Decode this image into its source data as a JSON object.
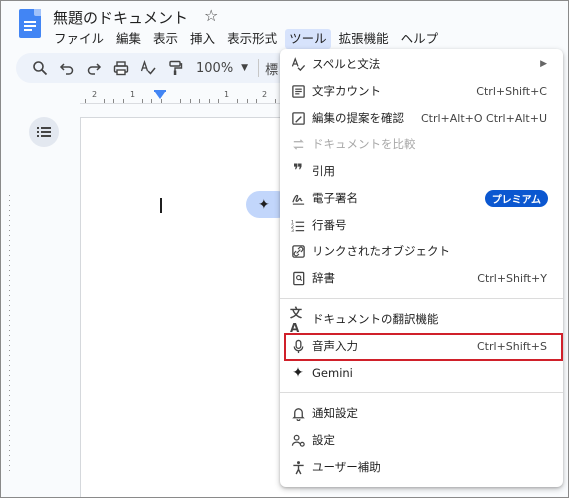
{
  "document": {
    "title": "無題のドキュメント"
  },
  "menubar": {
    "items": [
      {
        "label": "ファイル"
      },
      {
        "label": "編集"
      },
      {
        "label": "表示"
      },
      {
        "label": "挿入"
      },
      {
        "label": "表示形式"
      },
      {
        "label": "ツール"
      },
      {
        "label": "拡張機能"
      },
      {
        "label": "ヘルプ"
      }
    ]
  },
  "toolbar": {
    "zoom": "100%",
    "style_snippet": "標"
  },
  "ruler": {
    "numbers": [
      "2",
      "1",
      "1",
      "2"
    ]
  },
  "tools_menu": {
    "items": [
      {
        "label": "スペルと文法",
        "shortcut": "",
        "icon": "spellcheck-icon",
        "has_submenu": true
      },
      {
        "label": "文字カウント",
        "shortcut": "Ctrl+Shift+C",
        "icon": "word-count-icon"
      },
      {
        "label": "編集の提案を確認",
        "shortcut": "Ctrl+Alt+O Ctrl+Alt+U",
        "icon": "review-suggestions-icon"
      },
      {
        "label": "ドキュメントを比較",
        "shortcut": "",
        "icon": "compare-icon",
        "disabled": true
      },
      {
        "label": "引用",
        "shortcut": "",
        "icon": "quote-icon"
      },
      {
        "label": "電子署名",
        "shortcut": "",
        "icon": "signature-icon",
        "badge": "プレミアム"
      },
      {
        "label": "行番号",
        "shortcut": "",
        "icon": "line-numbers-icon"
      },
      {
        "label": "リンクされたオブジェクト",
        "shortcut": "",
        "icon": "linked-objects-icon"
      },
      {
        "label": "辞書",
        "shortcut": "Ctrl+Shift+Y",
        "icon": "dictionary-icon"
      },
      {
        "label": "ドキュメントの翻訳機能",
        "shortcut": "",
        "icon": "translate-icon"
      },
      {
        "label": "音声入力",
        "shortcut": "Ctrl+Shift+S",
        "icon": "microphone-icon",
        "highlighted": true
      },
      {
        "label": "Gemini",
        "shortcut": "",
        "icon": "sparkle-icon"
      },
      {
        "label": "通知設定",
        "shortcut": "",
        "icon": "bell-icon"
      },
      {
        "label": "設定",
        "shortcut": "",
        "icon": "preferences-icon"
      },
      {
        "label": "ユーザー補助",
        "shortcut": "",
        "icon": "accessibility-icon"
      }
    ]
  },
  "colors": {
    "accent": "#0b57d0",
    "doc_blue": "#4285f4",
    "highlight_border": "#d0202a",
    "gemini_chip": "#c2d6fb"
  }
}
